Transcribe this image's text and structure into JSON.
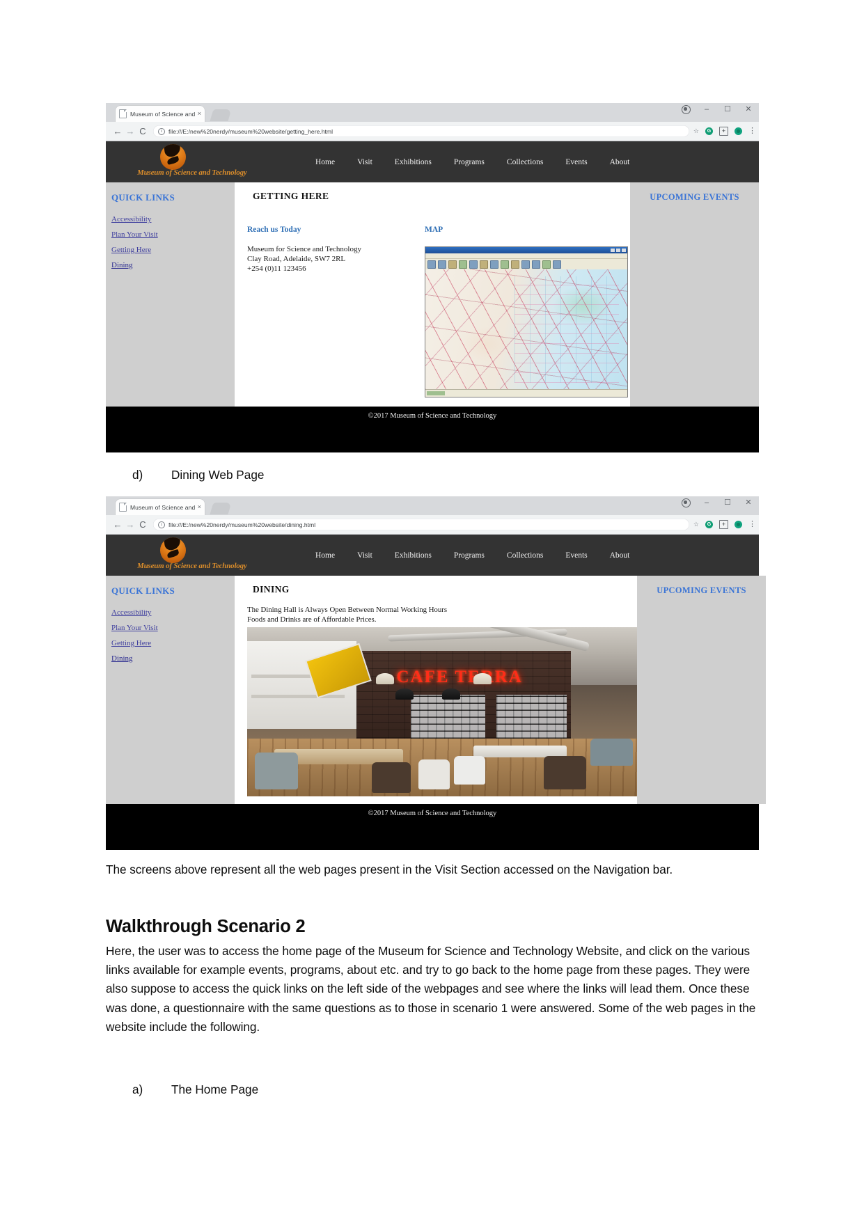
{
  "document": {
    "caption_d": {
      "marker": "d)",
      "text": "Dining Web Page"
    },
    "caption_a": {
      "marker": "a)",
      "text": "The Home Page"
    },
    "paragraph_1": "The screens above represent all the web pages present in the Visit Section accessed on the Navigation bar.",
    "heading_2": "Walkthrough Scenario 2",
    "paragraph_2": "Here, the user was to access the home page of the Museum for Science and Technology Website, and click on the various links available for example events, programs, about etc. and try to go back to the home page from these pages. They were also suppose to access the quick links on the left side of the webpages and see where the links will lead them. Once these was done, a questionnaire with the same questions as to those in scenario 1 were answered. Some of the web pages in the website include the following."
  },
  "browser_1": {
    "tab_title": "Museum of Science and",
    "tab_close": "×",
    "url": "file:///E:/new%20nerdy/museum%20website/getting_here.html",
    "back_icon": "←",
    "forward_icon": "→",
    "reload_icon": "C",
    "info_icon": "i",
    "star_icon": "☆",
    "ext_green_label": "G",
    "ext_plus_label": "+",
    "kebab_icon": "⋮",
    "minimize_icon": "–",
    "maximize_icon": "☐",
    "close_icon": "✕"
  },
  "browser_2": {
    "tab_title": "Museum of Science and",
    "tab_close": "×",
    "url": "file:///E:/new%20nerdy/museum%20website/dining.html",
    "back_icon": "←",
    "forward_icon": "→",
    "reload_icon": "C",
    "info_icon": "i",
    "star_icon": "☆",
    "ext_green_label": "G",
    "ext_plus_label": "+",
    "kebab_icon": "⋮",
    "minimize_icon": "–",
    "maximize_icon": "☐",
    "close_icon": "✕"
  },
  "site": {
    "logo_text": "Museum of Science and Technology",
    "nav": [
      {
        "label": "Home"
      },
      {
        "label": "Visit"
      },
      {
        "label": "Exhibitions"
      },
      {
        "label": "Programs"
      },
      {
        "label": "Collections"
      },
      {
        "label": "Events"
      },
      {
        "label": "About"
      }
    ],
    "quick_links_title": "QUICK LINKS",
    "quick_links": [
      {
        "label": "Accessibility"
      },
      {
        "label": "Plan Your Visit"
      },
      {
        "label": "Getting Here"
      },
      {
        "label": "Dining"
      }
    ],
    "upcoming_events_title": "UPCOMING EVENTS",
    "footer": "©2017 Museum of Science and Technology",
    "colors": {
      "header_bg": "#333333",
      "sidebar_bg": "#cfcfcf",
      "link_blue": "#3a74d6",
      "heading_blue": "#2f6fb5",
      "logo_orange": "#d98c2b",
      "footer_bg": "#000000"
    }
  },
  "page_getting_here": {
    "title": "GETTING HERE",
    "section_heading": "Reach us Today",
    "address_line_1": "Museum for Science and Technology",
    "address_line_2": "Clay Road, Adelaide, SW7 2RL",
    "address_line_3": "+254 (0)11 123456",
    "map_label": "MAP"
  },
  "page_dining": {
    "title": "DINING",
    "line_1": "The Dining Hall is Always Open Between Normal Working Hours",
    "line_2": "Foods and Drinks are of Affordable Prices.",
    "photo_sign_text": "CAFE TERRA"
  }
}
